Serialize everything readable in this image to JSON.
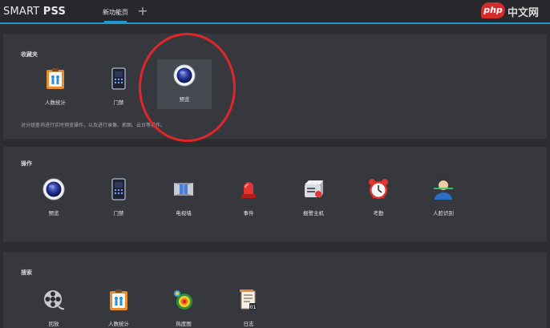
{
  "header": {
    "app_name_prefix": "SMART",
    "app_name_suffix": "PSS",
    "tab_label": "新功能页",
    "add_tab": "+",
    "watermark_logo": "php",
    "watermark_text": "中文网"
  },
  "favorites": {
    "title": "收藏夹",
    "hint": "对分组查询进行实时预览操作，以及进行录像、抓图、云台等操作。",
    "items": [
      {
        "label": "人数统计",
        "icon": "people-count-icon"
      },
      {
        "label": "门禁",
        "icon": "access-control-icon"
      },
      {
        "label": "预览",
        "icon": "preview-camera-icon"
      }
    ]
  },
  "operations": {
    "title": "操作",
    "items": [
      {
        "label": "预览",
        "icon": "preview-camera-icon"
      },
      {
        "label": "门禁",
        "icon": "access-control-icon"
      },
      {
        "label": "电视墙",
        "icon": "video-wall-icon"
      },
      {
        "label": "事件",
        "icon": "alarm-light-icon"
      },
      {
        "label": "报警主机",
        "icon": "alarm-host-icon"
      },
      {
        "label": "考勤",
        "icon": "alarm-clock-icon"
      },
      {
        "label": "人脸识别",
        "icon": "face-recognition-icon"
      }
    ]
  },
  "search": {
    "title": "搜索",
    "items": [
      {
        "label": "回放",
        "icon": "film-reel-icon"
      },
      {
        "label": "人数统计",
        "icon": "people-count-icon"
      },
      {
        "label": "热度图",
        "icon": "heatmap-icon"
      },
      {
        "label": "日志",
        "icon": "log-document-icon"
      }
    ]
  },
  "colors": {
    "accent": "#1e97d3",
    "annotation_circle": "#e0262a",
    "panel_bg": "#36383d"
  }
}
